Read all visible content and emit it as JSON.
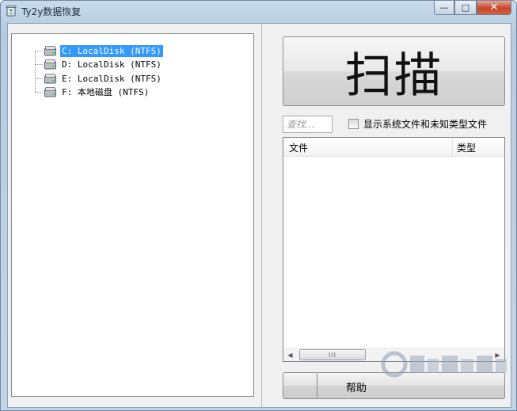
{
  "window": {
    "title": "Ty2y数据恢复",
    "controls": {
      "minimize": "—",
      "maximize": "□",
      "close": "✕"
    }
  },
  "tree": {
    "drives": [
      {
        "label": "C: LocalDisk (NTFS)",
        "selected": true,
        "icon": "hard-drive-icon"
      },
      {
        "label": "D: LocalDisk (NTFS)",
        "selected": false,
        "icon": "hard-drive-icon"
      },
      {
        "label": "E: LocalDisk (NTFS)",
        "selected": false,
        "icon": "hard-drive-icon"
      },
      {
        "label": "F: 本地磁盘 (NTFS)",
        "selected": false,
        "icon": "hard-drive-icon"
      }
    ]
  },
  "scan": {
    "label": "扫描"
  },
  "search": {
    "placeholder": "查找..."
  },
  "options": {
    "show_system_files_label": "显示系统文件和未知类型文件",
    "show_system_files_checked": false
  },
  "file_list": {
    "columns": [
      "文件",
      "类型"
    ],
    "scroll_grip": "III"
  },
  "buttons": {
    "help_label": "帮助"
  },
  "colors": {
    "selection": "#3399ff",
    "close_button": "#c8452b"
  }
}
